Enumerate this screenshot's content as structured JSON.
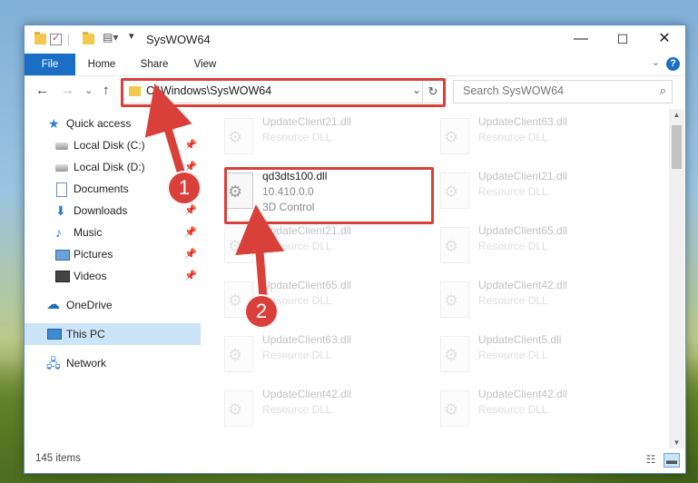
{
  "window": {
    "title": "SysWOW64",
    "buttons": {
      "minimize": "—",
      "maximize": "☐",
      "close": "✕"
    }
  },
  "ribbon": {
    "tabs": [
      "File",
      "Home",
      "Share",
      "View"
    ],
    "help": "?",
    "expand": "⌄"
  },
  "nav": {
    "back": "←",
    "forward": "→",
    "recent": "⌄",
    "up": "↑",
    "address": "C:\\Windows\\SysWOW64",
    "address_dropdown": "⌄",
    "refresh": "↻",
    "search_placeholder": "Search SysWOW64",
    "search_icon": "⌕"
  },
  "sidebar": {
    "items": [
      {
        "label": "Quick access",
        "icon": "star-icon",
        "pinned": false
      },
      {
        "label": "Local Disk (C:)",
        "icon": "drive-icon",
        "pinned": true
      },
      {
        "label": "Local Disk (D:)",
        "icon": "drive-icon",
        "pinned": true
      },
      {
        "label": "Documents",
        "icon": "document-icon",
        "pinned": true
      },
      {
        "label": "Downloads",
        "icon": "download-icon",
        "pinned": true
      },
      {
        "label": "Music",
        "icon": "music-icon",
        "pinned": true
      },
      {
        "label": "Pictures",
        "icon": "pictures-icon",
        "pinned": true
      },
      {
        "label": "Videos",
        "icon": "videos-icon",
        "pinned": true
      },
      {
        "label": "OneDrive",
        "icon": "cloud-icon",
        "pinned": false
      },
      {
        "label": "This PC",
        "icon": "computer-icon",
        "pinned": false,
        "selected": true
      },
      {
        "label": "Network",
        "icon": "network-icon",
        "pinned": false
      }
    ],
    "pin_glyph": "📌"
  },
  "files": {
    "left": [
      {
        "name": "UpdateClient21.dll",
        "desc": "Resource DLL"
      },
      {
        "name": "qd3dts100.dll",
        "desc": "10.410.0.0",
        "extra": "3D Control"
      },
      {
        "name": "UpdateClient21.dll",
        "desc": "Resource DLL"
      },
      {
        "name": "UpdateClient65.dll",
        "desc": "Resource DLL"
      },
      {
        "name": "UpdateClient63.dll",
        "desc": "Resource DLL"
      },
      {
        "name": "UpdateClient42.dll",
        "desc": "Resource DLL"
      }
    ],
    "right": [
      {
        "name": "UpdateClient63.dll",
        "desc": "Resource DLL"
      },
      {
        "name": "UpdateClient21.dll",
        "desc": "Resource DLL"
      },
      {
        "name": "UpdateClient65.dll",
        "desc": "Resource DLL"
      },
      {
        "name": "UpdateClient42.dll",
        "desc": "Resource DLL"
      },
      {
        "name": "UpdateClient5.dll",
        "desc": "Resource DLL"
      },
      {
        "name": "UpdateClient42.dll",
        "desc": "Resource DLL"
      }
    ]
  },
  "status": {
    "count": "145 items"
  },
  "callouts": {
    "step1": "1",
    "step2": "2",
    "color": "#d9403a"
  },
  "colors": {
    "accent": "#1a6fc4",
    "selection": "#cce4f7"
  }
}
